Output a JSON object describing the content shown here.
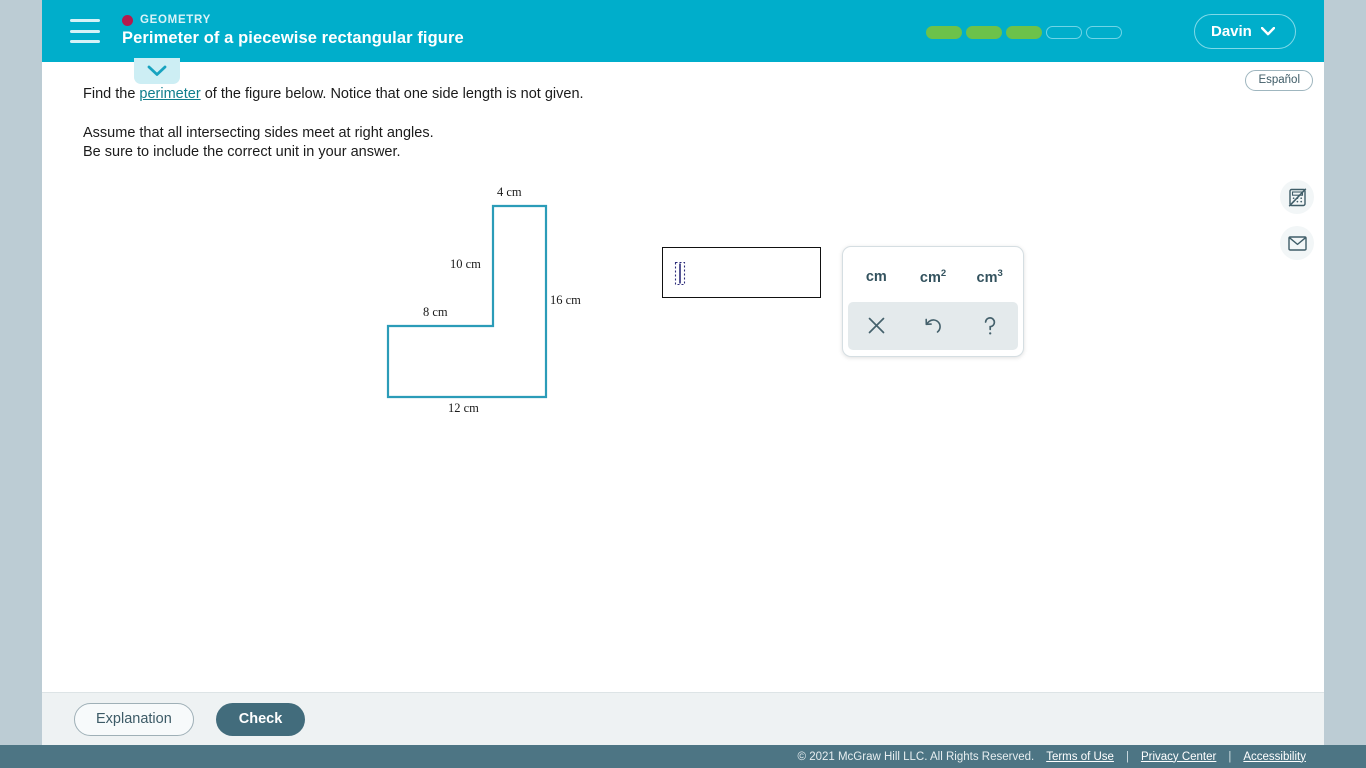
{
  "header": {
    "menu_icon": "hamburger-icon",
    "eyebrow": "GEOMETRY",
    "eyebrow_dot_color": "#b31b4d",
    "title": "Perimeter of a piecewise rectangular figure",
    "background_color": "#00aecb",
    "user_name": "Davin",
    "user_chevron_icon": "chevron-down-icon",
    "progress": {
      "total": 5,
      "filled": 3,
      "fill_color": "#6cc24a",
      "empty_border_color": "#6fd4e6"
    }
  },
  "subbar": {
    "collapse_icon": "chevron-down-icon",
    "espanol_label": "Español"
  },
  "problem": {
    "line1_before": "Find the ",
    "line1_link": "perimeter",
    "line1_after": " of the figure below. Notice that one side length is not given.",
    "line2": "Assume that all intersecting sides meet at right angles.",
    "line3": "Be sure to include the correct unit in your answer."
  },
  "figure": {
    "type": "piecewise-rectangular",
    "stroke_color": "#2b9cb8",
    "labels": [
      {
        "text": "4 cm",
        "name": "label-top-4cm"
      },
      {
        "text": "10 cm",
        "name": "label-inner-vertical-10cm"
      },
      {
        "text": "16 cm",
        "name": "label-right-16cm"
      },
      {
        "text": "8 cm",
        "name": "label-upper-horizontal-8cm"
      },
      {
        "text": "12 cm",
        "name": "label-bottom-12cm"
      }
    ]
  },
  "answer": {
    "input_value": "",
    "caret_icon": "math-placeholder-caret"
  },
  "unit_panel": {
    "units": [
      "cm",
      "cm2",
      "cm3"
    ],
    "unit_labels": [
      "cm",
      "cm",
      "cm"
    ],
    "unit_sup": [
      "",
      "2",
      "3"
    ],
    "tools": [
      {
        "name": "clear-button",
        "icon": "close-x-icon"
      },
      {
        "name": "undo-button",
        "icon": "undo-arrow-icon"
      },
      {
        "name": "help-button",
        "icon": "question-mark-icon"
      }
    ]
  },
  "rail": {
    "items": [
      {
        "name": "calculator-disabled-icon"
      },
      {
        "name": "mail-icon"
      }
    ]
  },
  "actions": {
    "explanation_label": "Explanation",
    "check_label": "Check",
    "check_color": "#426c7c"
  },
  "footer": {
    "copyright": "© 2021 McGraw Hill LLC. All Rights Reserved.",
    "links": [
      "Terms of Use",
      "Privacy Center",
      "Accessibility"
    ],
    "separator": "|",
    "background_color": "#4d7584"
  }
}
